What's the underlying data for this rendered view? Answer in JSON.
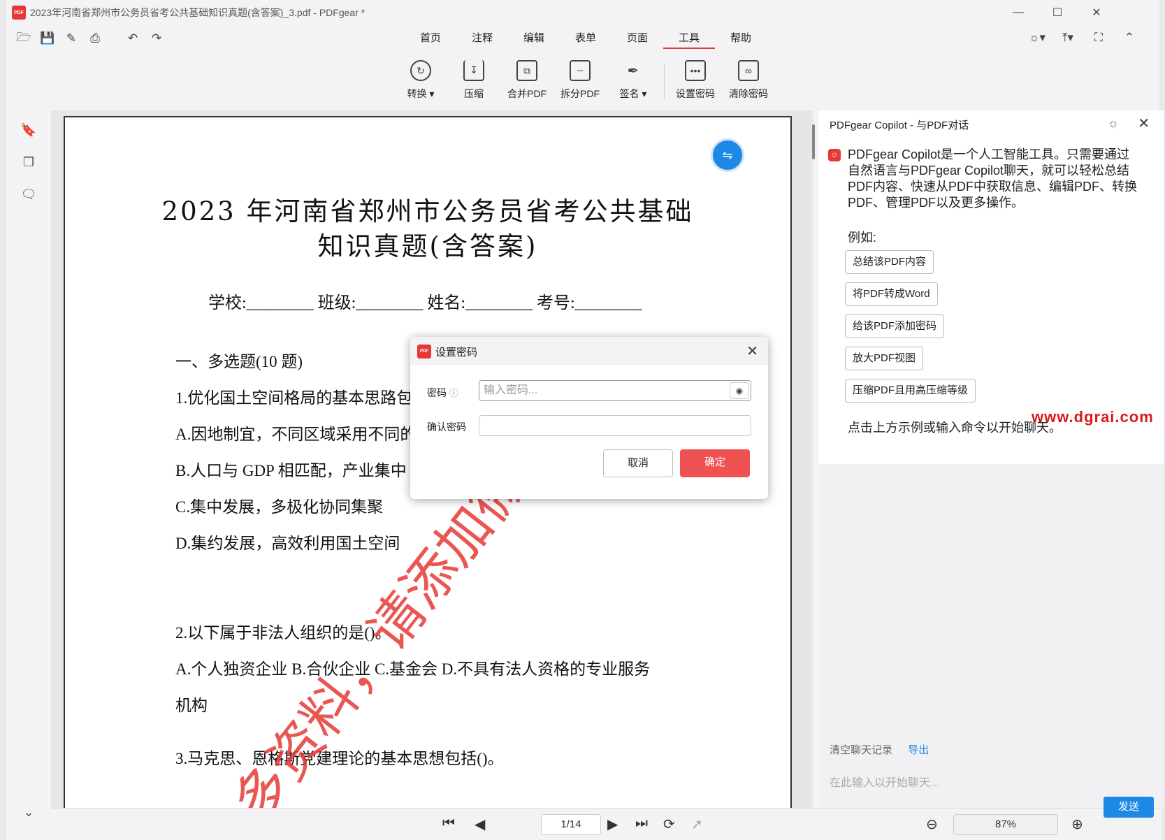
{
  "window": {
    "title": "2023年河南省郑州市公务员省考公共基础知识真题(含答案)_3.pdf - PDFgear *",
    "logo_text": "PDF"
  },
  "menu": {
    "tabs": [
      "首页",
      "注释",
      "编辑",
      "表单",
      "页面",
      "工具",
      "帮助"
    ],
    "active": "工具"
  },
  "ribbon": {
    "buttons": [
      {
        "label": "转换 ▾",
        "icon": "convert-icon"
      },
      {
        "label": "压缩",
        "icon": "compress-icon"
      },
      {
        "label": "合并PDF",
        "icon": "merge-icon"
      },
      {
        "label": "拆分PDF",
        "icon": "split-icon"
      },
      {
        "label": "签名 ▾",
        "icon": "signature-icon"
      },
      {
        "label": "设置密码",
        "icon": "lock-icon"
      },
      {
        "label": "清除密码",
        "icon": "unlock-icon"
      }
    ]
  },
  "document": {
    "title_line1": "2023 年河南省郑州市公务员省考公共基础",
    "title_line2": "知识真题(含答案)",
    "fields": "学校:________  班级:________  姓名:________  考号:________",
    "section": "一、多选题(10 题)",
    "q1": "1.优化国土空间格局的基本思路包",
    "q1a": "A.因地制宜，不同区域采用不同的",
    "q1b": "B.人口与 GDP 相匹配，产业集中",
    "q1c": "C.集中发展，多极化协同集聚",
    "q1d": "D.集约发展，高效利用国土空间",
    "q2": "2.以下属于非法人组织的是()。",
    "q2opts": "A.个人独资企业  B.合伙企业  C.基金会  D.不具有法人资格的专业服务",
    "q2cont": "机构",
    "q3": "3.马克思、恩格斯党建理论的基本思想包括()。",
    "watermark": "多资料，请添加微"
  },
  "pager": {
    "page": "1/14",
    "zoom": "87%"
  },
  "copilot": {
    "title": "PDFgear Copilot - 与PDF对话",
    "intro": "PDFgear Copilot是一个人工智能工具。只需要通过自然语言与PDFgear Copilot聊天，就可以轻松总结PDF内容、快速从PDF中获取信息、编辑PDF、转换PDF、管理PDF以及更多操作。",
    "example_label": "例如:",
    "examples": [
      "总结该PDF内容",
      "将PDF转成Word",
      "给该PDF添加密码",
      "放大PDF视图",
      "压缩PDF且用高压缩等级"
    ],
    "hint": "点击上方示例或输入命令以开始聊天。",
    "brand": "www.dgrai.com",
    "clear_label": "清空聊天记录",
    "export_label": "导出",
    "input_placeholder": "在此输入以开始聊天...",
    "send_label": "发送"
  },
  "dialog": {
    "title": "设置密码",
    "password_label": "密码",
    "password_placeholder": "输入密码...",
    "confirm_label": "确认密码",
    "cancel_label": "取消",
    "ok_label": "确定"
  },
  "colors": {
    "accent": "#e53935",
    "primary": "#1e88e5",
    "ok_button": "#ee5253"
  }
}
